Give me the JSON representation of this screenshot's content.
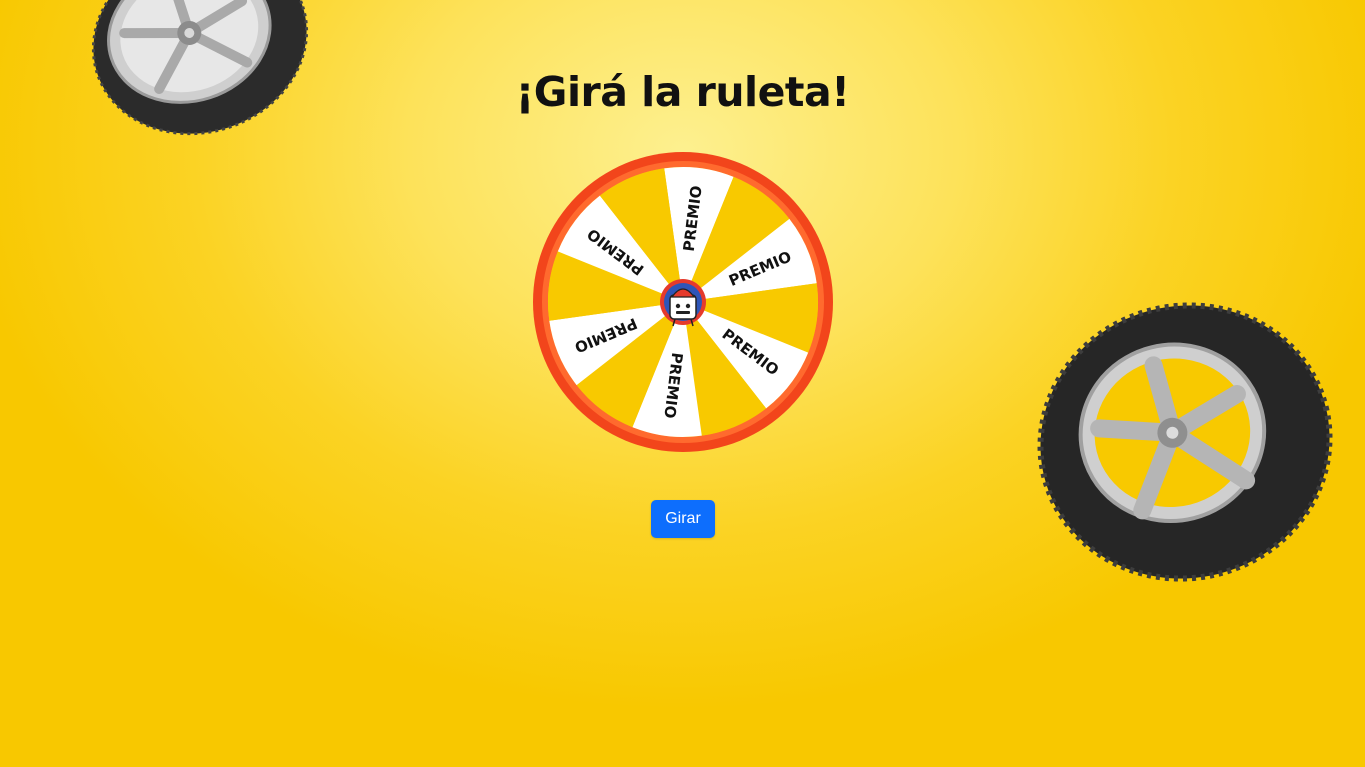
{
  "page": {
    "title": "¡Girá la ruleta!"
  },
  "wheel": {
    "slice_label": "PREMIO",
    "slices": [
      "PREMIO",
      "",
      "PREMIO",
      "",
      "PREMIO",
      "",
      "PREMIO",
      "",
      "PREMIO",
      "",
      "PREMIO",
      ""
    ],
    "colors": {
      "rim": "#f2451b",
      "slice_white": "#ffffff",
      "slice_yellow": "#f8c900",
      "hub": "#e53a2c"
    }
  },
  "controls": {
    "spin_label": "Girar",
    "spin_color": "#0d6efd"
  },
  "decor": {
    "icons": [
      "tire-icon",
      "tire-icon",
      "mascot-icon"
    ]
  }
}
